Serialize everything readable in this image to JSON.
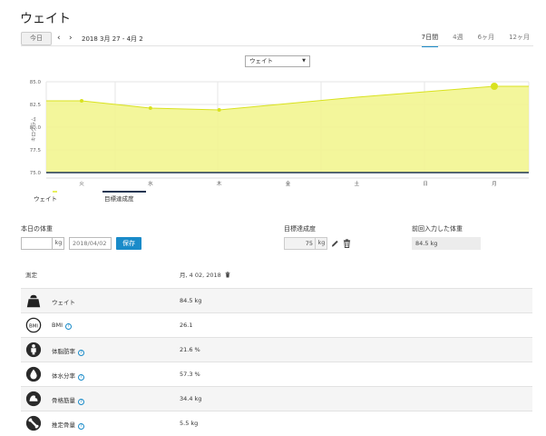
{
  "page_title": "ウェイト",
  "toolbar": {
    "today_label": "今日",
    "prev_icon": "‹",
    "next_icon": "›",
    "date_range": "2018 3月 27 - 4月 2",
    "periods": [
      "7日間",
      "4週",
      "6ヶ月",
      "12ヶ月"
    ],
    "active_period": "7日間"
  },
  "metric_select": {
    "value": "ウェイト"
  },
  "chart_data": {
    "type": "area",
    "categories": [
      "火",
      "水",
      "木",
      "金",
      "土",
      "日",
      "月"
    ],
    "series": [
      {
        "name": "ウェイト",
        "values": [
          82.9,
          82.1,
          81.9,
          82.6,
          83.3,
          83.9,
          84.5
        ]
      },
      {
        "name": "目標達成度",
        "values": [
          75,
          75,
          75,
          75,
          75,
          75,
          75
        ]
      }
    ],
    "ylabel": "キログラム",
    "yticks": [
      "85.0",
      "82.5",
      "80.0",
      "77.5",
      "75.0"
    ],
    "ylim": [
      75,
      85
    ],
    "grid": true,
    "colors": {
      "area_fill": "#f1f58a",
      "line": "#d9e21f",
      "goal_line": "#1f3552"
    }
  },
  "legend": {
    "weight": "ウェイト",
    "goal": "目標達成度"
  },
  "today_weight": {
    "label": "本日の体重",
    "unit": "kg",
    "date": "2018/04/02",
    "save_label": "保存"
  },
  "goal": {
    "label": "目標達成度",
    "value": "75",
    "unit": "kg"
  },
  "previous": {
    "label": "前回入力した体重",
    "value": "84.5 kg"
  },
  "table": {
    "header_label": "測定",
    "header_date": "月, 4 02, 2018",
    "rows": [
      {
        "label": "ウェイト",
        "value": "84.5 kg",
        "icon": "scale-weight-icon",
        "info": false
      },
      {
        "label": "BMI",
        "value": "26.1",
        "icon": "bmi-icon",
        "info": true
      },
      {
        "label": "体脂肪率",
        "value": "21.6 %",
        "icon": "body-fat-icon",
        "info": true
      },
      {
        "label": "体水分率",
        "value": "57.3 %",
        "icon": "body-water-icon",
        "info": true
      },
      {
        "label": "骨格筋量",
        "value": "34.4 kg",
        "icon": "muscle-icon",
        "info": true
      },
      {
        "label": "推定骨量",
        "value": "5.5 kg",
        "icon": "bone-icon",
        "info": true
      }
    ]
  },
  "colors": {
    "accent": "#1a8bc9"
  }
}
